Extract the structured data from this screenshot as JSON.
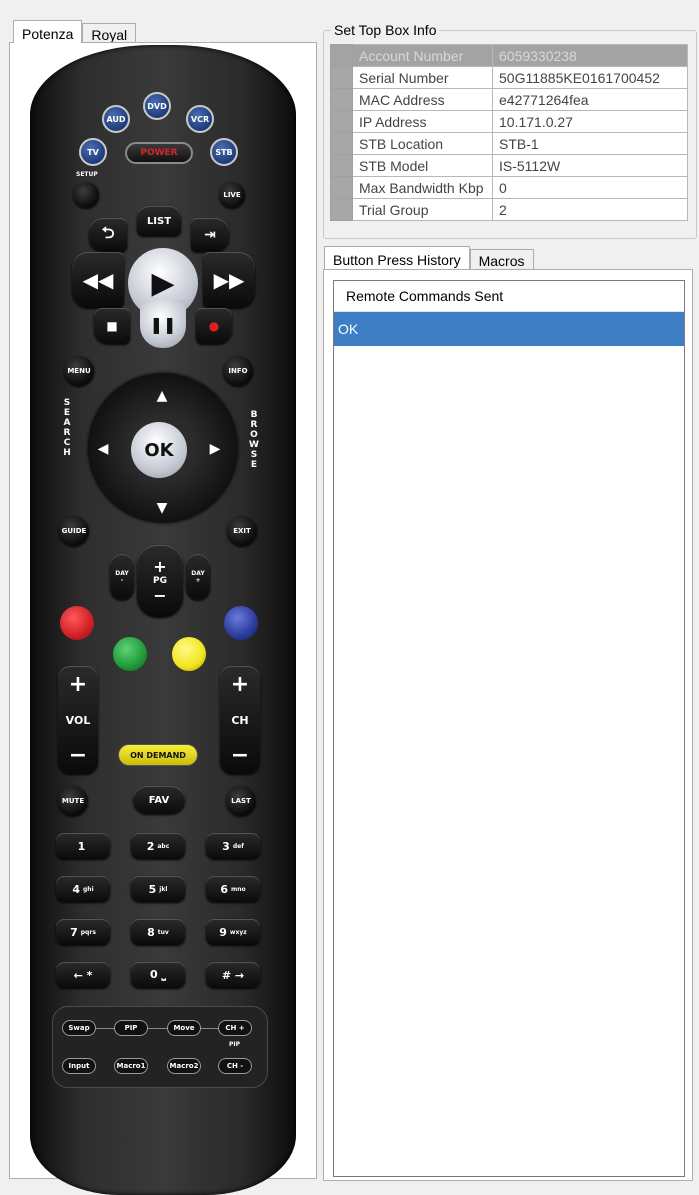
{
  "left_tabs": [
    "Potenza",
    "Royal"
  ],
  "remote": {
    "aud": "AUD",
    "dvd": "DVD",
    "vcr": "VCR",
    "tv": "TV",
    "power": "POWER",
    "stb": "STB",
    "setup": "SETUP",
    "live": "LIVE",
    "list": "LIST",
    "menu": "MENU",
    "info": "INFO",
    "ok": "OK",
    "search_letters": [
      "S",
      "E",
      "A",
      "R",
      "C",
      "H"
    ],
    "browse_letters": [
      "B",
      "R",
      "O",
      "W",
      "S",
      "E"
    ],
    "guide": "GUIDE",
    "exit": "EXIT",
    "day_minus": "DAY\n-",
    "day_plus": "DAY\n+",
    "pg": "PG",
    "plus": "+",
    "minus": "−",
    "vol": "VOL",
    "ch": "CH",
    "on_demand": "ON DEMAND",
    "mute": "MUTE",
    "fav": "FAV",
    "last": "LAST",
    "keys": [
      {
        "n": "1",
        "s": ""
      },
      {
        "n": "2",
        "s": "abc"
      },
      {
        "n": "3",
        "s": "def"
      },
      {
        "n": "4",
        "s": "ghi"
      },
      {
        "n": "5",
        "s": "jkl"
      },
      {
        "n": "6",
        "s": "mno"
      },
      {
        "n": "7",
        "s": "pqrs"
      },
      {
        "n": "8",
        "s": "tuv"
      },
      {
        "n": "9",
        "s": "wxyz"
      },
      {
        "n": "← *",
        "s": ""
      },
      {
        "n": "0 ⎵",
        "s": ""
      },
      {
        "n": "# →",
        "s": ""
      }
    ],
    "swap": "Swap",
    "pip": "PIP",
    "move": "Move",
    "ch_plus": "CH +",
    "pip_small": "PIP",
    "input": "Input",
    "macro1": "Macro1",
    "macro2": "Macro2",
    "ch_minus": "CH -"
  },
  "stb_info": {
    "title": "Set Top Box Info",
    "rows": [
      {
        "key": "Account Number",
        "value": "6059330238"
      },
      {
        "key": "Serial Number",
        "value": "50G11885KE0161700452"
      },
      {
        "key": "MAC Address",
        "value": "e42771264fea"
      },
      {
        "key": "IP Address",
        "value": "10.171.0.27"
      },
      {
        "key": "STB Location",
        "value": "STB-1"
      },
      {
        "key": "STB Model",
        "value": "IS-5112W"
      },
      {
        "key": "Max Bandwidth Kbp",
        "value": "0"
      },
      {
        "key": "Trial Group",
        "value": "2"
      }
    ]
  },
  "right_tabs": [
    "Button Press History",
    "Macros"
  ],
  "history": {
    "header": "Remote Commands Sent",
    "items": [
      "OK"
    ]
  },
  "colors": {
    "red": "#d01f25",
    "green": "#1f9a36",
    "yellow": "#f2e51b",
    "blue": "#2a3b9c",
    "selection": "#3d7ec4"
  }
}
